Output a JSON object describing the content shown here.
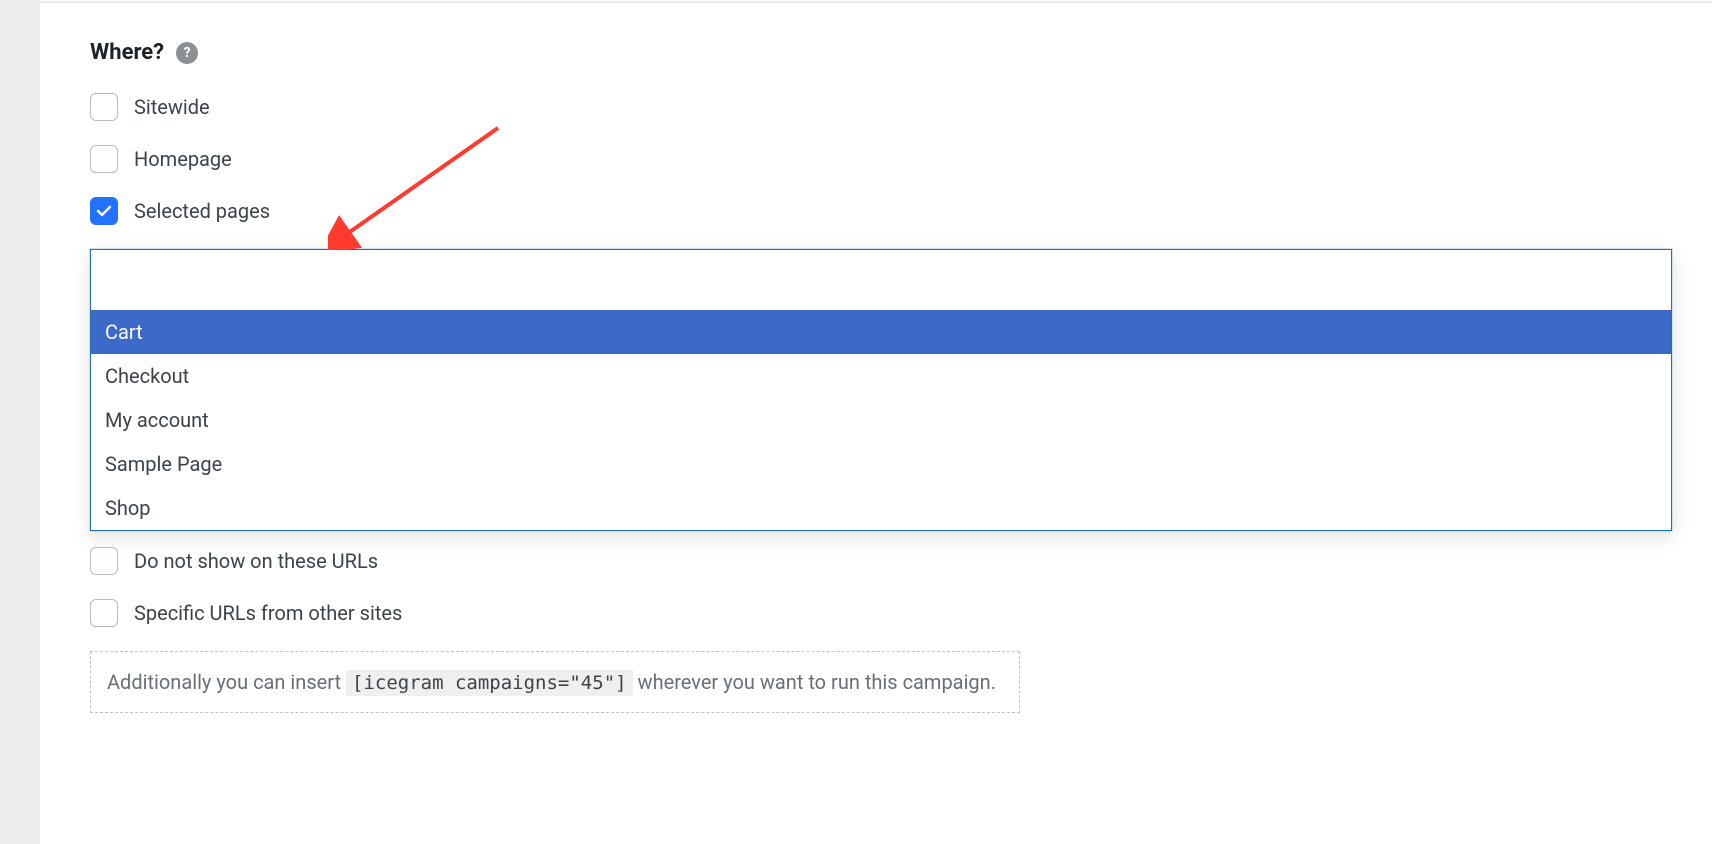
{
  "section": {
    "title": "Where?"
  },
  "checkboxes": {
    "sitewide": {
      "label": "Sitewide",
      "checked": false
    },
    "homepage": {
      "label": "Homepage",
      "checked": false
    },
    "selected": {
      "label": "Selected pages",
      "checked": true
    },
    "noturls": {
      "label": "Do not show on these URLs",
      "checked": false
    },
    "specific": {
      "label": "Specific URLs from other sites",
      "checked": false
    }
  },
  "dropdown": {
    "input_value": "",
    "options": [
      "Cart",
      "Checkout",
      "My account",
      "Sample Page",
      "Shop"
    ],
    "highlighted_index": 0
  },
  "hint": {
    "before": "Additionally you can insert ",
    "code": "[icegram campaigns=\"45\"]",
    "after": " wherever you want to run this campaign."
  }
}
